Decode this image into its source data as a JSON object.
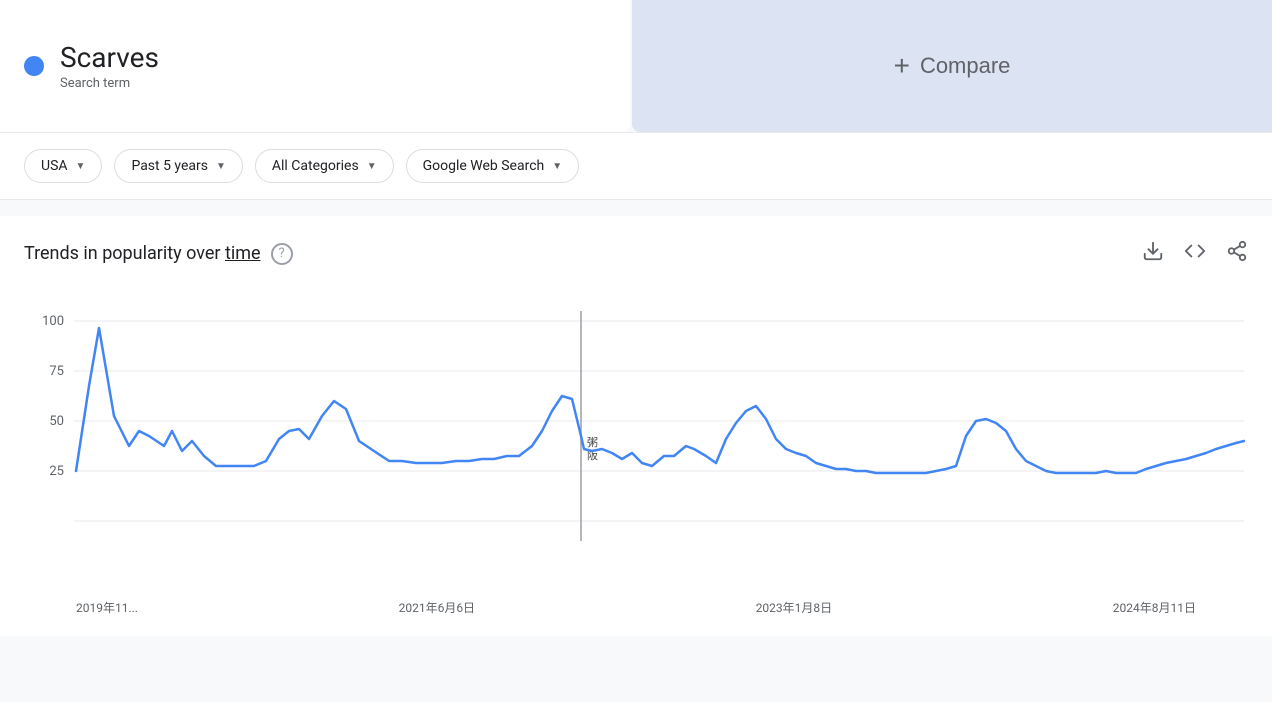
{
  "searchTerm": {
    "name": "Scarves",
    "type": "Search term",
    "dotColor": "#4285f4"
  },
  "compare": {
    "label": "Compare",
    "plusSymbol": "+"
  },
  "filters": {
    "country": {
      "label": "USA",
      "hasDropdown": true
    },
    "timeRange": {
      "label": "Past 5 years",
      "hasDropdown": true
    },
    "categories": {
      "label": "All Categories",
      "hasDropdown": true
    },
    "searchType": {
      "label": "Google Web Search",
      "hasDropdown": true
    }
  },
  "chart": {
    "title_start": "Trends in popularity over ",
    "title_underline": "time",
    "helpIcon": "?",
    "downloadIcon": "⬇",
    "embedIcon": "<>",
    "shareIcon": "⎋",
    "yAxisLabels": [
      "100",
      "75",
      "50",
      "25"
    ],
    "xAxisLabels": [
      "2019年11...",
      "2021年6月6日",
      "2023年1月8日",
      "2024年8月11日"
    ],
    "verticalLineX": 557,
    "tooltipText": "粥\n阪"
  }
}
